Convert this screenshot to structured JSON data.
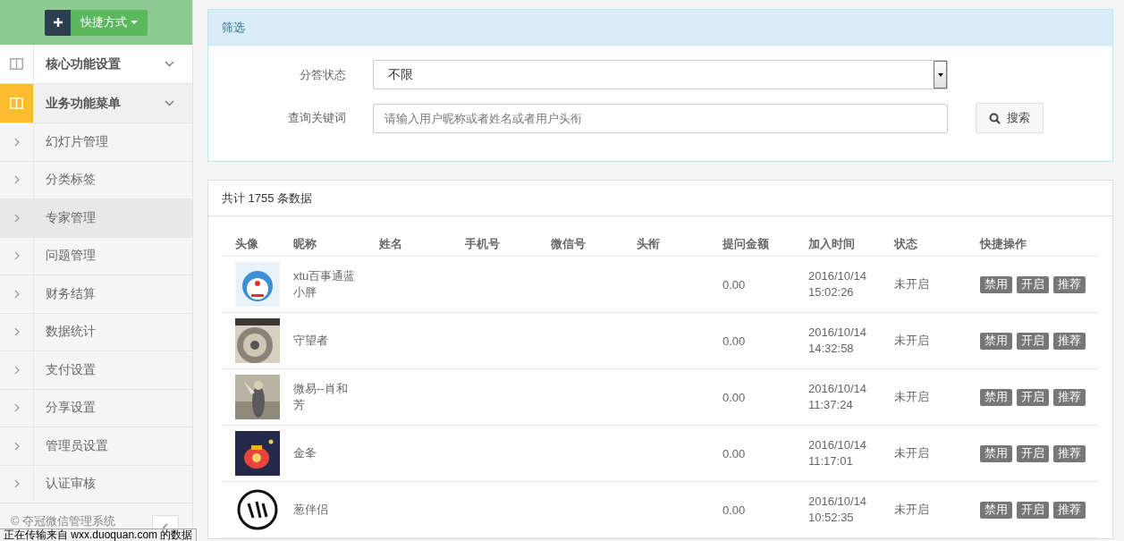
{
  "sidebar": {
    "shortcut_button": "快捷方式",
    "groups": [
      {
        "label": "核心功能设置",
        "active": false
      },
      {
        "label": "业务功能菜单",
        "active": true
      }
    ],
    "items": [
      {
        "label": "幻灯片管理",
        "selected": false
      },
      {
        "label": "分类标签",
        "selected": false
      },
      {
        "label": "专家管理",
        "selected": true
      },
      {
        "label": "问题管理",
        "selected": false
      },
      {
        "label": "财务结算",
        "selected": false
      },
      {
        "label": "数据统计",
        "selected": false
      },
      {
        "label": "支付设置",
        "selected": false
      },
      {
        "label": "分享设置",
        "selected": false
      },
      {
        "label": "管理员设置",
        "selected": false
      },
      {
        "label": "认证审核",
        "selected": false
      }
    ],
    "footer": "© 夺冠微信管理系统"
  },
  "filter": {
    "title": "筛选",
    "fields": [
      {
        "kind": "select",
        "label": "分答状态",
        "value": "不限"
      },
      {
        "kind": "text",
        "label": "查询关键词",
        "placeholder": "请输入用户昵称或者姓名或者用户头衔"
      }
    ],
    "search_button": "搜索"
  },
  "table": {
    "summary": "共计 1755 条数据",
    "columns": [
      "头像",
      "昵称",
      "姓名",
      "手机号",
      "微信号",
      "头衔",
      "提问金额",
      "加入时间",
      "状态",
      "快捷操作"
    ],
    "rows": [
      {
        "nickname": "xtu百事通蓝小胖",
        "amount": "0.00",
        "join_date": "2016/10/14",
        "join_time": "15:02:26",
        "status": "未开启",
        "actions": [
          "禁用",
          "开启",
          "推荐"
        ]
      },
      {
        "nickname": "守望者",
        "amount": "0.00",
        "join_date": "2016/10/14",
        "join_time": "14:32:58",
        "status": "未开启",
        "actions": [
          "禁用",
          "开启",
          "推荐"
        ]
      },
      {
        "nickname": "微易--肖和芳",
        "amount": "0.00",
        "join_date": "2016/10/14",
        "join_time": "11:37:24",
        "status": "未开启",
        "actions": [
          "禁用",
          "开启",
          "推荐"
        ]
      },
      {
        "nickname": "金夆",
        "amount": "0.00",
        "join_date": "2016/10/14",
        "join_time": "11:17:01",
        "status": "未开启",
        "actions": [
          "禁用",
          "开启",
          "推荐"
        ]
      },
      {
        "nickname": "葱伴侣",
        "amount": "0.00",
        "join_date": "2016/10/14",
        "join_time": "10:52:35",
        "status": "未开启",
        "actions": [
          "禁用",
          "开启",
          "推荐"
        ]
      }
    ]
  },
  "status_bar": "正在传输来自 wxx.duoquan.com 的数据"
}
